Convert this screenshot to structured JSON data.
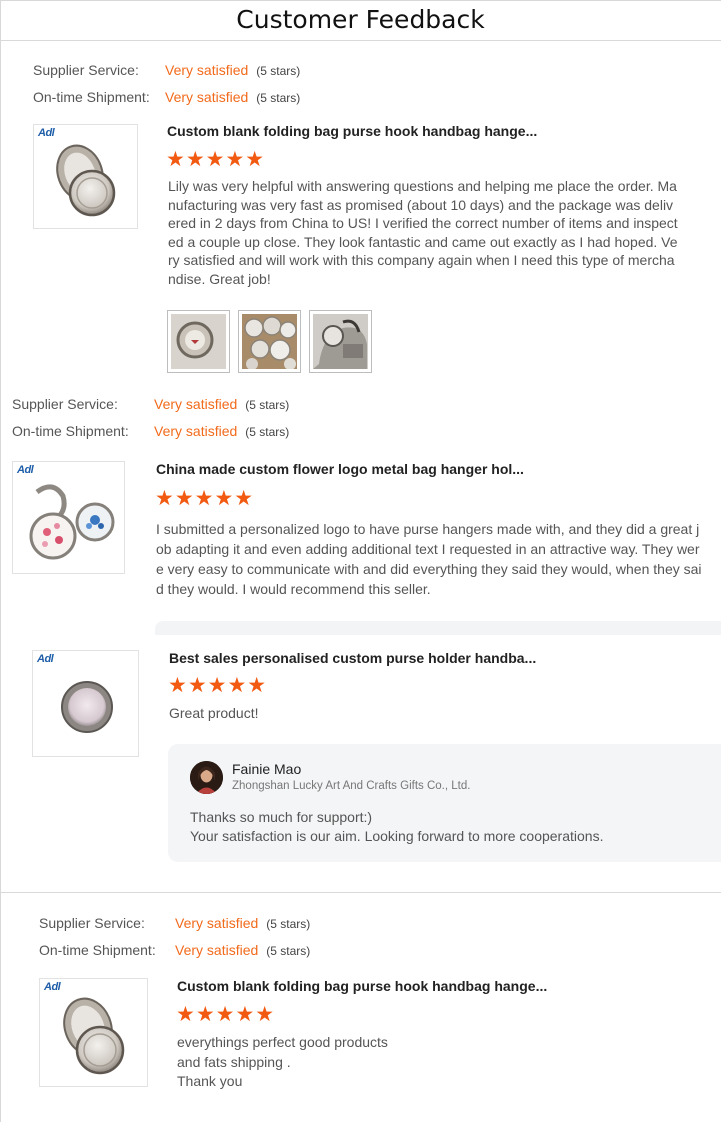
{
  "header": {
    "title": "Customer Feedback"
  },
  "labels": {
    "supplier_service": "Supplier Service:",
    "ontime_shipment": "On-time Shipment:",
    "very_satisfied": "Very satisfied",
    "five_stars": "(5 stars)"
  },
  "brand_mark": "Adl",
  "star_glyphs": "★★★★★",
  "reviews": [
    {
      "supplier_service": "Very satisfied",
      "supplier_stars": "(5 stars)",
      "shipment": "Very satisfied",
      "shipment_stars": "(5 stars)",
      "product_title": "Custom blank folding bag purse hook handbag hange...",
      "rating": 5,
      "text": "Lily was very helpful with answering questions and helping me place the order.  Manufacturing was very fast as promised (about 10 days) and the package was delivered in 2 days from China to US!  I verified the correct number of items and inspected a couple up close.  They look fantastic and came out exactly as I had hoped.  Very satisfied and will work with this company again when I need this type of merchandise.  Great job!",
      "photo_count": 3
    },
    {
      "supplier_service": "Very satisfied",
      "supplier_stars": "(5 stars)",
      "shipment": "Very satisfied",
      "shipment_stars": "(5 stars)",
      "product_title": "China made custom flower logo metal bag hanger hol...",
      "rating": 5,
      "text": "I submitted a personalized logo to have purse hangers made with, and they did a great job adapting it and even adding additional text I requested in an attractive way.  They were very easy to communicate with and did everything they said they would, when they said they would.  I would recommend this seller."
    },
    {
      "product_title": "Best sales personalised custom purse holder handba...",
      "rating": 5,
      "text": "Great product!",
      "reply": {
        "name": "Fainie Mao",
        "company": "Zhongshan Lucky Art And Crafts Gifts Co., Ltd.",
        "line1": "Thanks so much for support:)",
        "line2": "Your satisfaction is our aim. Looking forward to more cooperations."
      }
    },
    {
      "supplier_service": "Very satisfied",
      "supplier_stars": "(5 stars)",
      "shipment": "Very satisfied",
      "shipment_stars": "(5 stars)",
      "product_title": "Custom blank folding bag purse hook handbag hange...",
      "rating": 5,
      "text_lines": [
        "everythings perfect good products",
        "and fats shipping .",
        "Thank you"
      ]
    }
  ],
  "colors": {
    "accent": "#f26a1b",
    "star": "#f25a12",
    "reply_bg": "#f4f5f7"
  }
}
